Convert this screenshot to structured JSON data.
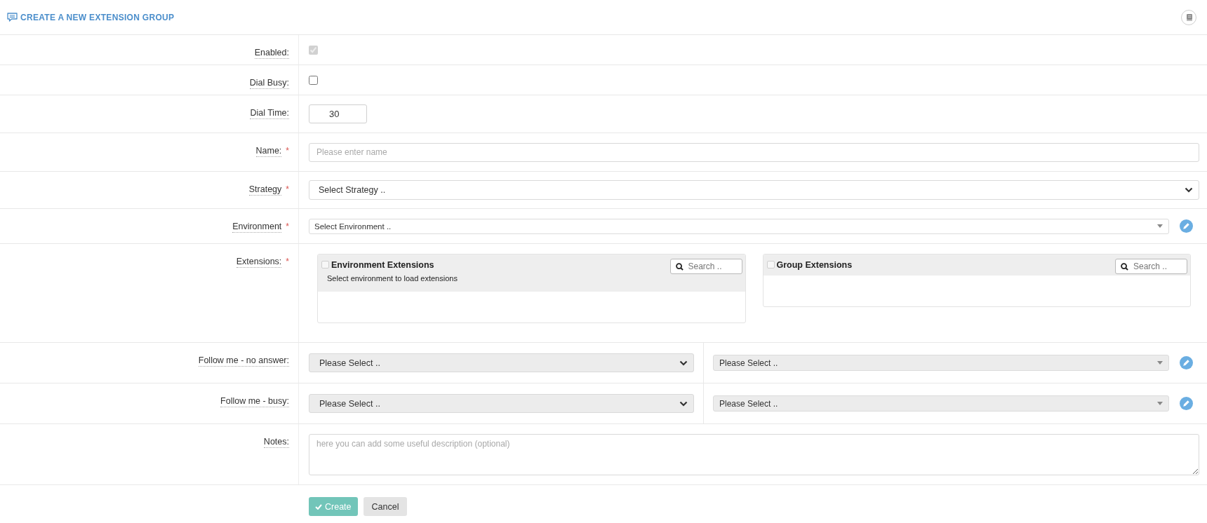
{
  "header": {
    "title": "CREATE A NEW EXTENSION GROUP"
  },
  "rows": [
    {
      "kind": "checkbox",
      "label": "Enabled:",
      "checked": true,
      "disabled": true
    },
    {
      "kind": "checkbox",
      "label": "Dial Busy:",
      "checked": false,
      "disabled": false
    },
    {
      "kind": "number",
      "label": "Dial Time:",
      "value": "30"
    },
    {
      "kind": "text",
      "label": "Name:",
      "required_mark": "*",
      "placeholder": "Please enter name"
    },
    {
      "kind": "select",
      "label": "Strategy",
      "required_mark": "*",
      "value": "Select Strategy .."
    },
    {
      "kind": "combo",
      "label": "Environment",
      "required_mark": "*",
      "value": "Select Environment ..",
      "editable": true
    },
    {
      "kind": "extensions",
      "label": "Extensions:",
      "required_mark": "*",
      "panels": [
        {
          "title": "Environment Extensions",
          "checked": false,
          "search_placeholder": "Search ..",
          "message": "Select environment to load extensions"
        },
        {
          "title": "Group Extensions",
          "checked": false,
          "search_placeholder": "Search .."
        }
      ]
    },
    {
      "kind": "pair",
      "label": "Follow me - no answer:",
      "primary": "Please Select ..",
      "secondary": "Please Select ..",
      "editable": true
    },
    {
      "kind": "pair",
      "label": "Follow me - busy:",
      "primary": "Please Select ..",
      "secondary": "Please Select ..",
      "editable": true
    },
    {
      "kind": "textarea",
      "label": "Notes:",
      "placeholder": "here you can add some useful description (optional)"
    }
  ],
  "actions": [
    {
      "kind": "primary",
      "label": "Create"
    },
    {
      "kind": "secondary",
      "label": "Cancel"
    }
  ]
}
